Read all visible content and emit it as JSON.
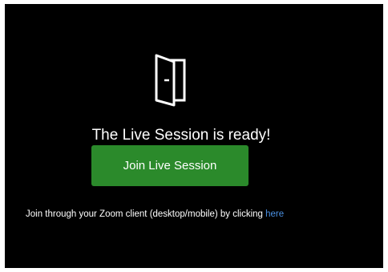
{
  "session": {
    "heading": "The Live Session is ready!",
    "join_button_label": "Join Live Session",
    "zoom_text": "Join through your Zoom client (desktop/mobile) by clicking ",
    "zoom_link_text": "here"
  },
  "colors": {
    "background": "#000000",
    "button": "#2b8a2b",
    "link": "#4a90e2",
    "text": "#ffffff"
  },
  "icons": {
    "door": "door-open-icon"
  }
}
